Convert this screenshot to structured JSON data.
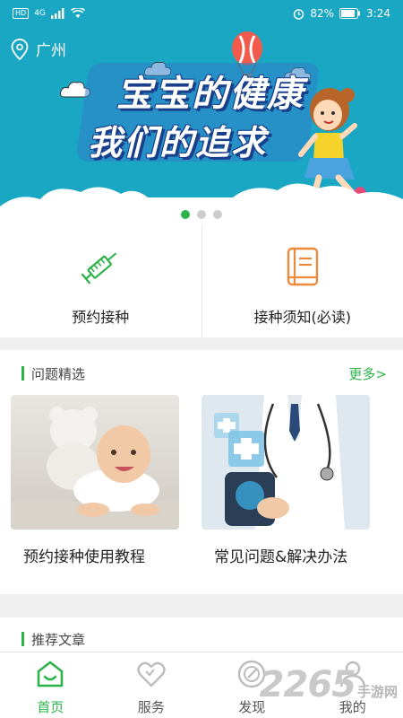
{
  "status_bar": {
    "network": "HD",
    "signal_label": "4G",
    "battery": "82%",
    "time": "3:24"
  },
  "location": {
    "city": "广州",
    "icon": "location-pin-icon"
  },
  "banner": {
    "line1": "宝宝的健康",
    "line2": "我们的追求",
    "dots_total": 3,
    "active_dot": 1
  },
  "quick_actions": [
    {
      "label": "预约接种",
      "icon": "syringe-icon"
    },
    {
      "label": "接种须知(必读)",
      "icon": "book-icon"
    }
  ],
  "featured": {
    "title": "问题精选",
    "more": "更多>",
    "items": [
      {
        "label": "预约接种使用教程",
        "image": "baby-photo"
      },
      {
        "label": "常见问题&解决办法",
        "image": "doctor-photo"
      }
    ]
  },
  "articles": {
    "title": "推荐文章"
  },
  "tabs": [
    {
      "label": "首页",
      "icon": "home-icon",
      "active": true
    },
    {
      "label": "服务",
      "icon": "heart-icon",
      "active": false
    },
    {
      "label": "发现",
      "icon": "compass-icon",
      "active": false
    },
    {
      "label": "我的",
      "icon": "user-icon",
      "active": false
    }
  ],
  "watermark": {
    "number": "2265",
    "text": "手游网"
  },
  "colors": {
    "accent": "#2db34a",
    "banner": "#1aa7c4",
    "orange": "#f08a3a"
  }
}
